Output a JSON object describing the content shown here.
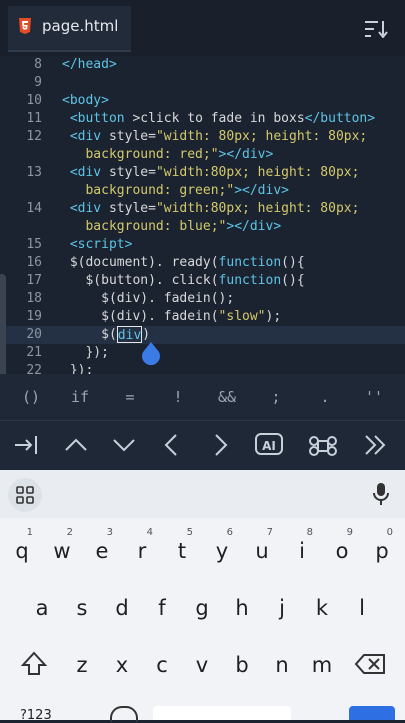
{
  "tab": {
    "title": "page.html"
  },
  "code_lines": [
    {
      "n": "8",
      "parts": [
        {
          "t": "</head>",
          "c": "tag"
        }
      ]
    },
    {
      "n": "9",
      "parts": []
    },
    {
      "n": "10",
      "parts": [
        {
          "t": "<body>",
          "c": "tag"
        }
      ]
    },
    {
      "n": "11",
      "parts": [
        {
          "t": " <button ",
          "c": "tag"
        },
        {
          "t": ">click to fade in boxs",
          "c": "attr"
        },
        {
          "t": "</button>",
          "c": "tag"
        }
      ]
    },
    {
      "n": "12",
      "parts": [
        {
          "t": " <div ",
          "c": "tag"
        },
        {
          "t": "style=",
          "c": "attr"
        },
        {
          "t": "\"width: 80px; height: 80px;",
          "c": "str"
        }
      ]
    },
    {
      "n": "",
      "parts": [
        {
          "t": "   background: red;\"",
          "c": "str"
        },
        {
          "t": "></div>",
          "c": "tag"
        }
      ]
    },
    {
      "n": "13",
      "parts": [
        {
          "t": " <div ",
          "c": "tag"
        },
        {
          "t": "style=",
          "c": "attr"
        },
        {
          "t": "\"width:80px; height: 80px;",
          "c": "str"
        }
      ]
    },
    {
      "n": "",
      "parts": [
        {
          "t": "   background: green;\"",
          "c": "str"
        },
        {
          "t": "></div>",
          "c": "tag"
        }
      ]
    },
    {
      "n": "14",
      "parts": [
        {
          "t": " <div ",
          "c": "tag"
        },
        {
          "t": "style=",
          "c": "attr"
        },
        {
          "t": "\"width:80px; height: 80px;",
          "c": "str"
        }
      ]
    },
    {
      "n": "",
      "parts": [
        {
          "t": "   background: blue;\"",
          "c": "str"
        },
        {
          "t": "></div>",
          "c": "tag"
        }
      ]
    },
    {
      "n": "15",
      "parts": [
        {
          "t": " <script>",
          "c": "tag"
        }
      ]
    },
    {
      "n": "16",
      "parts": [
        {
          "t": " $(document). ready(",
          "c": "fn"
        },
        {
          "t": "function",
          "c": "kw"
        },
        {
          "t": "(){",
          "c": "fn"
        }
      ]
    },
    {
      "n": "17",
      "parts": [
        {
          "t": "   $(button). click(",
          "c": "fn"
        },
        {
          "t": "function",
          "c": "kw"
        },
        {
          "t": "(){",
          "c": "fn"
        }
      ]
    },
    {
      "n": "18",
      "parts": [
        {
          "t": "     $(div). fadein();",
          "c": "fn"
        }
      ]
    },
    {
      "n": "19",
      "parts": [
        {
          "t": "     $(div). fadein(",
          "c": "fn"
        },
        {
          "t": "\"slow\"",
          "c": "str"
        },
        {
          "t": ");",
          "c": "fn"
        }
      ]
    },
    {
      "n": "20",
      "parts": [
        {
          "t": "     $(",
          "c": "fn"
        },
        {
          "t": "div",
          "c": "kw"
        },
        {
          "t": ")",
          "c": "fn"
        }
      ],
      "current": true
    },
    {
      "n": "21",
      "parts": [
        {
          "t": "   });",
          "c": "fn"
        }
      ]
    },
    {
      "n": "22",
      "parts": [
        {
          "t": " });",
          "c": "fn"
        }
      ]
    }
  ],
  "symbols": [
    "()",
    "if",
    "=",
    "!",
    "&&",
    ";",
    ".",
    "''"
  ],
  "keyboard": {
    "row1": [
      {
        "k": "q",
        "s": "1"
      },
      {
        "k": "w",
        "s": "2"
      },
      {
        "k": "e",
        "s": "3"
      },
      {
        "k": "r",
        "s": "4"
      },
      {
        "k": "t",
        "s": "5"
      },
      {
        "k": "y",
        "s": "6"
      },
      {
        "k": "u",
        "s": "7"
      },
      {
        "k": "i",
        "s": "8"
      },
      {
        "k": "o",
        "s": "9"
      },
      {
        "k": "p",
        "s": "0"
      }
    ],
    "row2": [
      "a",
      "s",
      "d",
      "f",
      "g",
      "h",
      "j",
      "k",
      "l"
    ],
    "row3": [
      "z",
      "x",
      "c",
      "v",
      "b",
      "n",
      "m"
    ],
    "num_label": "?123"
  },
  "ai_label": "AI",
  "colors": {
    "accent": "#2f6fe4",
    "drop": "#3a7be6"
  }
}
